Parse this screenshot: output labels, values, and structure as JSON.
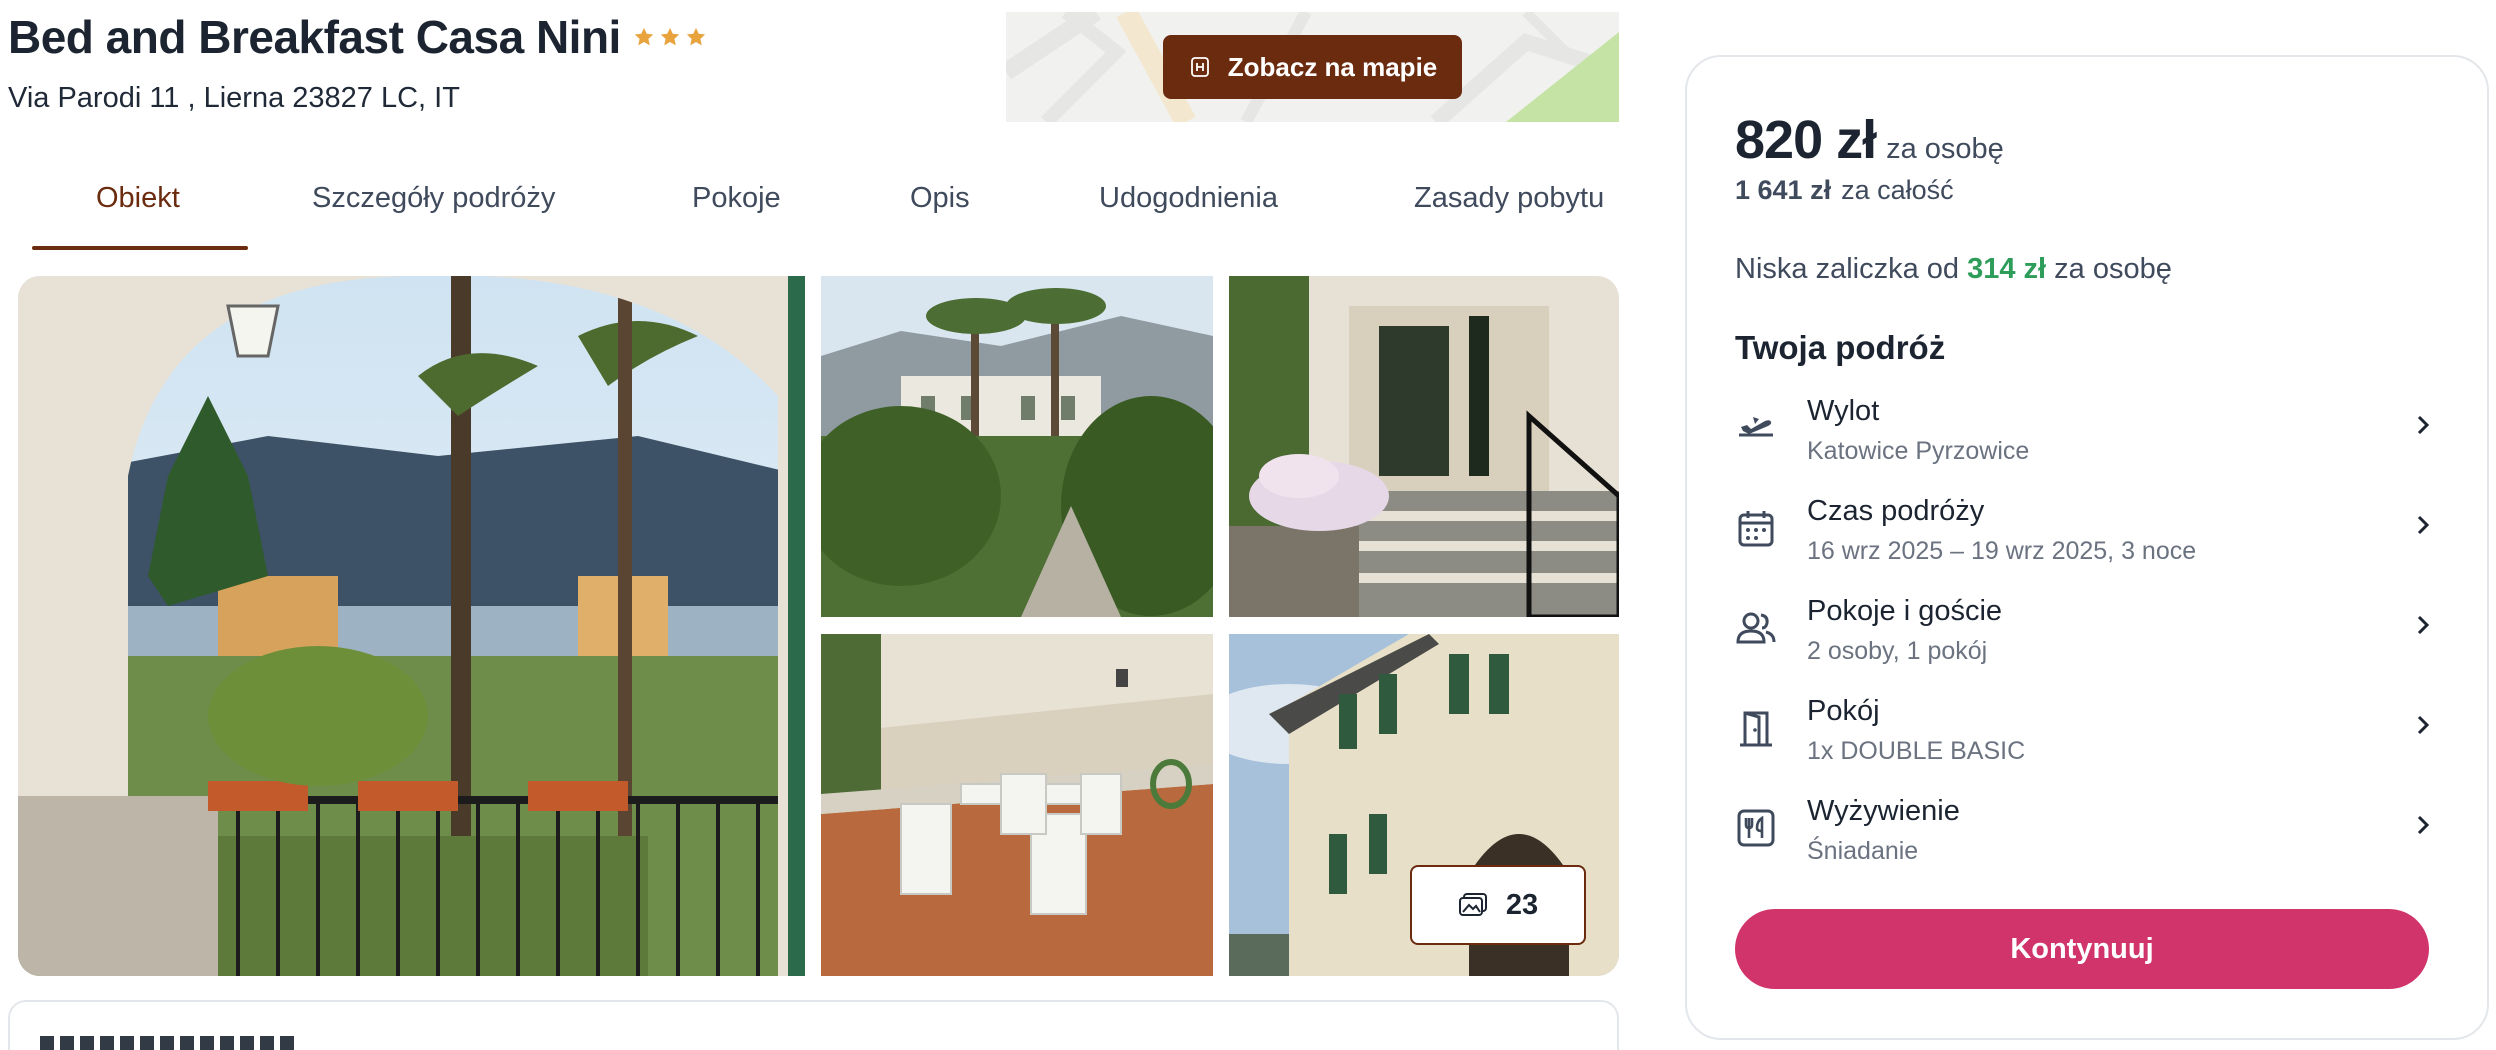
{
  "header": {
    "title": "Bed and Breakfast Casa Nini",
    "stars": 3,
    "address": "Via Parodi 11 , Lierna 23827 LC, IT"
  },
  "map": {
    "button_label": "Zobacz na mapie",
    "icon": "hotel-icon"
  },
  "tabs": [
    {
      "label": "Obiekt",
      "active": true
    },
    {
      "label": "Szczegóły podróży",
      "active": false
    },
    {
      "label": "Pokoje",
      "active": false
    },
    {
      "label": "Opis",
      "active": false
    },
    {
      "label": "Udogodnienia",
      "active": false
    },
    {
      "label": "Zasady pobytu",
      "active": false
    }
  ],
  "gallery": {
    "photo_count": "23",
    "icon": "photos-icon"
  },
  "booking": {
    "price": "820 zł",
    "price_per": "za osobę",
    "total": "1 641 zł",
    "total_label": "za całość",
    "deposit_prefix": "Niska zaliczka od",
    "deposit_amount": "314 zł",
    "deposit_suffix": "za osobę",
    "trip_title": "Twoja podróż",
    "items": [
      {
        "label": "Wylot",
        "value": "Katowice Pyrzowice",
        "icon": "plane-departure-icon"
      },
      {
        "label": "Czas podróży",
        "value": "16 wrz 2025 – 19 wrz 2025, 3 noce",
        "icon": "calendar-icon"
      },
      {
        "label": "Pokoje i goście",
        "value": "2 osoby, 1 pokój",
        "icon": "guests-icon"
      },
      {
        "label": "Pokój",
        "value": "1x DOUBLE BASIC",
        "icon": "door-icon"
      },
      {
        "label": "Wyżywienie",
        "value": "Śniadanie",
        "icon": "cutlery-icon"
      }
    ],
    "continue_label": "Kontynuuj"
  },
  "colors": {
    "brand": "#6b2b0f",
    "cta": "#d0346a",
    "deposit": "#2e9d5a",
    "star": "#e8a33d"
  }
}
